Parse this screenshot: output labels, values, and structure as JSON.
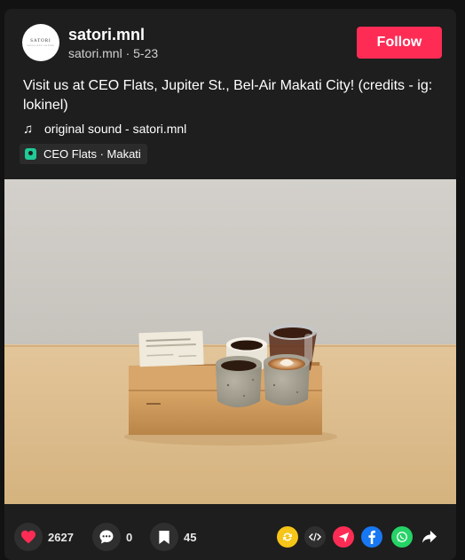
{
  "author": {
    "avatar_text": "SATORI",
    "avatar_subtext": "SPECIALTY COFFEE",
    "username": "satori.mnl",
    "handle": "satori.mnl",
    "date": "5-23"
  },
  "follow_label": "Follow",
  "caption": "Visit us at CEO Flats, Jupiter St., Bel-Air Makati City! (credits - ig: lokinel)",
  "sound": "original sound - satori.mnl",
  "location": "CEO Flats · Makati",
  "actions": {
    "likes": "2627",
    "comments": "0",
    "saves": "45"
  },
  "share_icons": [
    "repost-icon",
    "embed-icon",
    "send-icon",
    "facebook-icon",
    "whatsapp-icon",
    "share-arrow-icon"
  ],
  "colors": {
    "accent": "#fe2c55",
    "background": "#1e1e1e",
    "location_pin": "#20c997",
    "repost": "#f5c518",
    "send": "#fe2c55",
    "facebook": "#1877f2",
    "whatsapp": "#25d366"
  }
}
